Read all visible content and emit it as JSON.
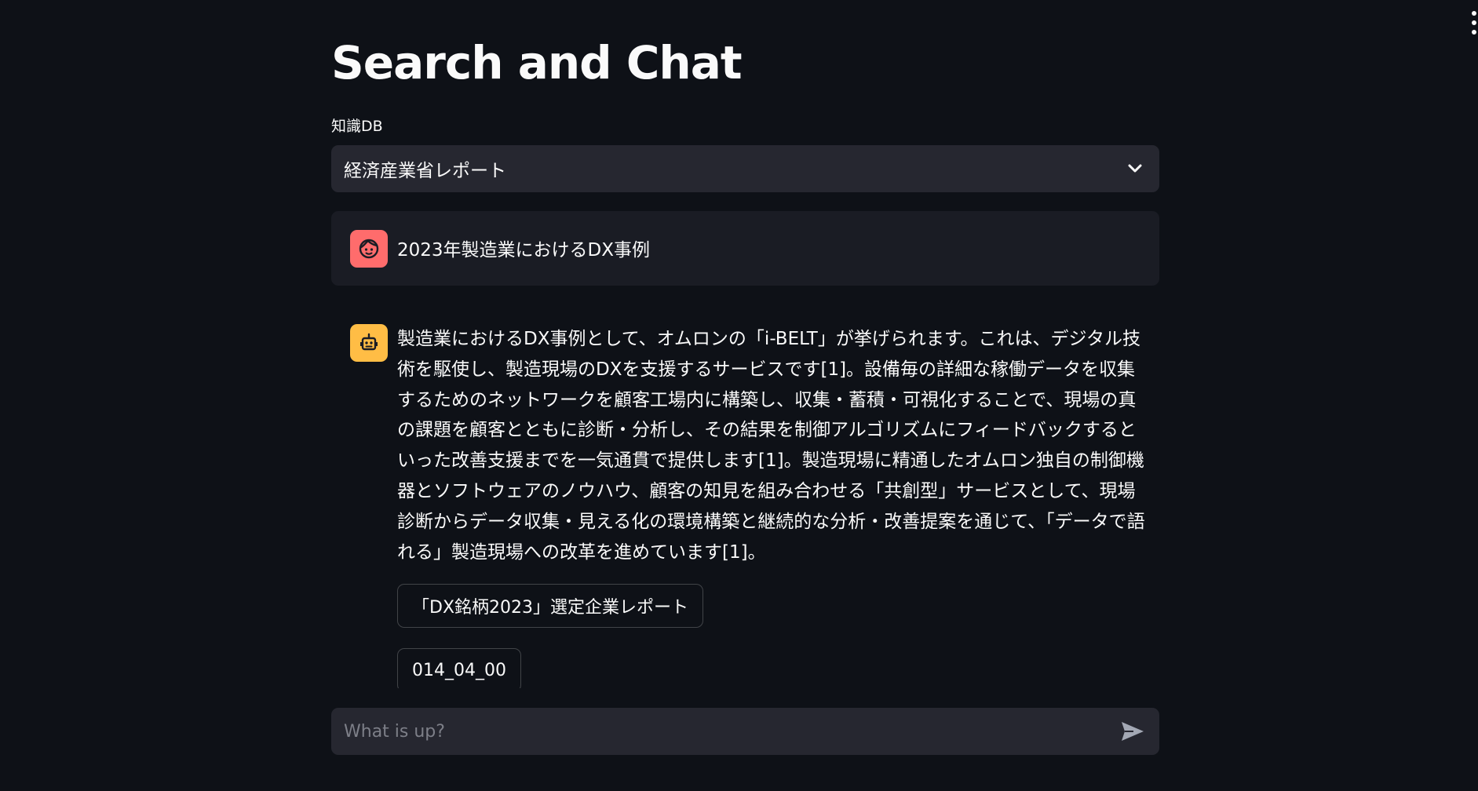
{
  "header": {
    "menu_icon": "more-vertical-icon"
  },
  "page": {
    "title": "Search and Chat"
  },
  "knowledge_db": {
    "label": "知識DB",
    "selected": "経済産業省レポート",
    "icon": "chevron-down-icon"
  },
  "chat": {
    "user_message": {
      "avatar_icon": "user-face-icon",
      "avatar_color": "#ff6c6c",
      "text": "2023年製造業におけるDX事例"
    },
    "assistant_message": {
      "avatar_icon": "robot-icon",
      "avatar_color": "#ffbd45",
      "text": "製造業におけるDX事例として、オムロンの「i-BELT」が挙げられます。これは、デジタル技術を駆使し、製造現場のDXを支援するサービスです[1]。設備毎の詳細な稼働データを収集するためのネットワークを顧客工場内に構築し、収集・蓄積・可視化することで、現場の真の課題を顧客とともに診断・分析し、その結果を制御アルゴリズムにフィードバックするといった改善支援までを一気通貫で提供します[1]。製造現場に精通したオムロン独自の制御機器とソフトウェアのノウハウ、顧客の知見を組み合わせる「共創型」サービスとして、現場診断からデータ収集・見える化の環境構築と継続的な分析・改善提案を通じて、「データで語れる」製造現場への改革を進めています[1]。",
      "sources": [
        "「DX銘柄2023」選定企業レポート",
        "014_04_00"
      ]
    }
  },
  "input": {
    "placeholder": "What is up?",
    "send_icon": "send-icon"
  },
  "colors": {
    "background": "#0e1117",
    "surface": "#262730",
    "user_bubble": "#1a1c24",
    "text": "#fafafa"
  }
}
